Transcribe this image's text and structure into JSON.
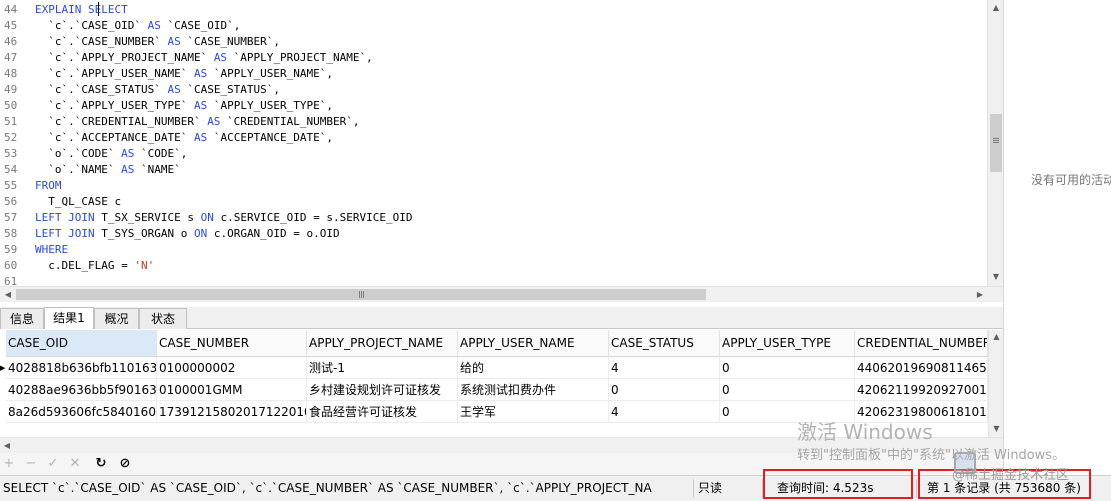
{
  "editor": {
    "line_numbers": [
      "44",
      "45",
      "46",
      "47",
      "48",
      "49",
      "50",
      "51",
      "52",
      "53",
      "54",
      "55",
      "56",
      "57",
      "58",
      "59",
      "60",
      "61"
    ],
    "lines": [
      [
        {
          "t": "EXPLAIN SELECT",
          "c": "kw"
        }
      ],
      [
        {
          "t": "  `c`.`CASE_OID` ",
          "c": ""
        },
        {
          "t": "AS",
          "c": "kw"
        },
        {
          "t": " `CASE_OID`,",
          "c": ""
        }
      ],
      [
        {
          "t": "  `c`.`CASE_NUMBER` ",
          "c": ""
        },
        {
          "t": "AS",
          "c": "kw"
        },
        {
          "t": " `CASE_NUMBER`,",
          "c": ""
        }
      ],
      [
        {
          "t": "  `c`.`APPLY_PROJECT_NAME` ",
          "c": ""
        },
        {
          "t": "AS",
          "c": "kw"
        },
        {
          "t": " `APPLY_PROJECT_NAME`,",
          "c": ""
        }
      ],
      [
        {
          "t": "  `c`.`APPLY_USER_NAME` ",
          "c": ""
        },
        {
          "t": "AS",
          "c": "kw"
        },
        {
          "t": " `APPLY_USER_NAME`,",
          "c": ""
        }
      ],
      [
        {
          "t": "  `c`.`CASE_STATUS` ",
          "c": ""
        },
        {
          "t": "AS",
          "c": "kw"
        },
        {
          "t": " `CASE_STATUS`,",
          "c": ""
        }
      ],
      [
        {
          "t": "  `c`.`APPLY_USER_TYPE` ",
          "c": ""
        },
        {
          "t": "AS",
          "c": "kw"
        },
        {
          "t": " `APPLY_USER_TYPE`,",
          "c": ""
        }
      ],
      [
        {
          "t": "  `c`.`CREDENTIAL_NUMBER` ",
          "c": ""
        },
        {
          "t": "AS",
          "c": "kw"
        },
        {
          "t": " `CREDENTIAL_NUMBER`,",
          "c": ""
        }
      ],
      [
        {
          "t": "  `c`.`ACCEPTANCE_DATE` ",
          "c": ""
        },
        {
          "t": "AS",
          "c": "kw"
        },
        {
          "t": " `ACCEPTANCE_DATE`,",
          "c": ""
        }
      ],
      [
        {
          "t": "  `o`.`CODE` ",
          "c": ""
        },
        {
          "t": "AS",
          "c": "kw"
        },
        {
          "t": " `CODE`,",
          "c": ""
        }
      ],
      [
        {
          "t": "  `o`.`NAME` ",
          "c": ""
        },
        {
          "t": "AS",
          "c": "kw"
        },
        {
          "t": " `NAME`",
          "c": ""
        }
      ],
      [
        {
          "t": "FROM",
          "c": "kw"
        }
      ],
      [
        {
          "t": "  T_QL_CASE c",
          "c": ""
        }
      ],
      [
        {
          "t": "LEFT JOIN",
          "c": "kw"
        },
        {
          "t": " T_SX_SERVICE s ",
          "c": ""
        },
        {
          "t": "ON",
          "c": "kw"
        },
        {
          "t": " c.SERVICE_OID = s.SERVICE_OID",
          "c": ""
        }
      ],
      [
        {
          "t": "LEFT JOIN",
          "c": "kw"
        },
        {
          "t": " T_SYS_ORGAN o ",
          "c": ""
        },
        {
          "t": "ON",
          "c": "kw"
        },
        {
          "t": " c.ORGAN_OID = o.OID",
          "c": ""
        }
      ],
      [
        {
          "t": "WHERE",
          "c": "kw"
        }
      ],
      [
        {
          "t": "  c.DEL_FLAG = ",
          "c": ""
        },
        {
          "t": "'N'",
          "c": "str"
        }
      ],
      [
        {
          "t": "",
          "c": ""
        }
      ]
    ]
  },
  "right_panel": {
    "message": "没有可用的活动"
  },
  "tabs": [
    {
      "label": "信息",
      "active": false
    },
    {
      "label": "结果1",
      "active": true
    },
    {
      "label": "概况",
      "active": false
    },
    {
      "label": "状态",
      "active": false
    }
  ],
  "grid": {
    "columns": [
      "CASE_OID",
      "CASE_NUMBER",
      "APPLY_PROJECT_NAME",
      "APPLY_USER_NAME",
      "CASE_STATUS",
      "APPLY_USER_TYPE",
      "CREDENTIAL_NUMBER"
    ],
    "rows": [
      [
        "4028818b636bfb1101636",
        "0100000002",
        "测试-1",
        "给的",
        "4",
        "0",
        "44062019690811465"
      ],
      [
        "40288ae9636bb5f901636",
        "0100001GMM",
        "乡村建设规划许可证核发",
        "系统测试扣费办件",
        "0",
        "0",
        "420621199209270014"
      ],
      [
        "8a26d593606fc58401607",
        "17391215802017122010034",
        "食品经营许可证核发",
        "王学军",
        "4",
        "0",
        "42062319800618101X"
      ]
    ],
    "current_row": 0
  },
  "toolbar": {
    "icons": [
      "add-icon",
      "delete-icon",
      "apply-icon",
      "discard-icon",
      "refresh-icon",
      "stop-icon"
    ],
    "glyphs": [
      "+",
      "−",
      "✓",
      "✕",
      "↻",
      "⊘"
    ]
  },
  "statusbar": {
    "sql": "SELECT   `c`.`CASE_OID` AS `CASE_OID`,       `c`.`CASE_NUMBER` AS `CASE_NUMBER`,       `c`.`APPLY_PROJECT_NA",
    "readonly": "只读",
    "query_time": "查询时间: 4.523s",
    "record_info": "第 1 条记录 (共 753680 条)"
  },
  "watermark": {
    "title": "激活 Windows",
    "subtitle": "转到\"控制面板\"中的\"系统\"以激活 Windows。",
    "brand": "@稀土掘金技术社区"
  },
  "colors": {
    "keyword": "#2a4bd3",
    "string": "#c0392b",
    "highlight_box": "#e02020",
    "selected_header": "#dbe8f7"
  }
}
